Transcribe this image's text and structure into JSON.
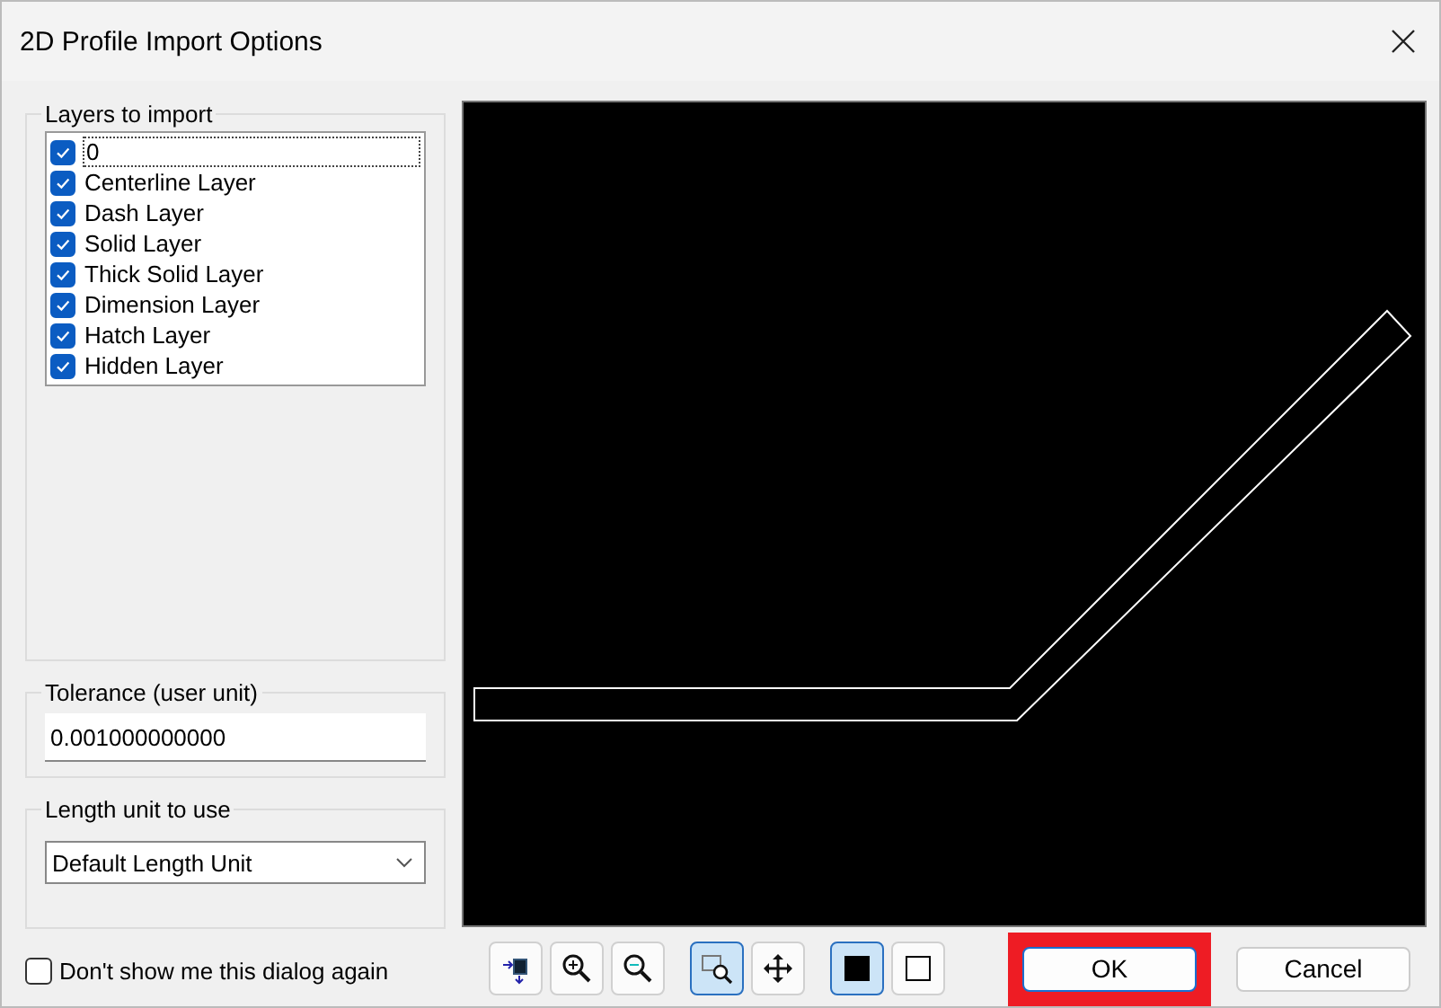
{
  "window": {
    "title": "2D Profile Import Options"
  },
  "layers": {
    "title": "Layers to import",
    "items": [
      {
        "label": "0",
        "checked": true,
        "focused": true
      },
      {
        "label": "Centerline Layer",
        "checked": true,
        "focused": false
      },
      {
        "label": "Dash Layer",
        "checked": true,
        "focused": false
      },
      {
        "label": "Solid Layer",
        "checked": true,
        "focused": false
      },
      {
        "label": "Thick Solid Layer",
        "checked": true,
        "focused": false
      },
      {
        "label": "Dimension Layer",
        "checked": true,
        "focused": false
      },
      {
        "label": "Hatch Layer",
        "checked": true,
        "focused": false
      },
      {
        "label": "Hidden Layer",
        "checked": true,
        "focused": false
      }
    ]
  },
  "tolerance": {
    "title": "Tolerance (user unit)",
    "value": "0.001000000000"
  },
  "length_unit": {
    "title": "Length unit to use",
    "value": "Default Length Unit"
  },
  "dont_show": {
    "label": "Don't show me this dialog again",
    "checked": false
  },
  "toolbar": [
    {
      "kind": "fit",
      "selected": false
    },
    {
      "kind": "zoom-in",
      "selected": false
    },
    {
      "kind": "zoom-out",
      "selected": false
    },
    {
      "kind": "zoom-window",
      "selected": true
    },
    {
      "kind": "pan",
      "selected": false
    },
    {
      "kind": "filled",
      "selected": true
    },
    {
      "kind": "outline",
      "selected": false
    }
  ],
  "buttons": [
    {
      "label": "OK",
      "highlighted": true
    },
    {
      "label": "Cancel",
      "highlighted": false
    }
  ]
}
